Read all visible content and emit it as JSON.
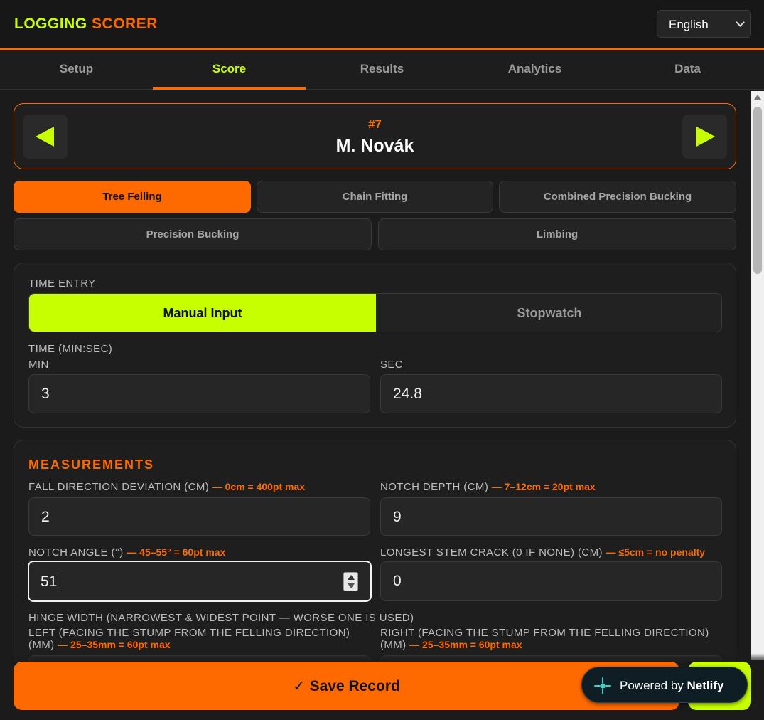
{
  "header": {
    "logo_part1": "LOGGING",
    "logo_part2": "SCORER",
    "language": "English"
  },
  "tabs": [
    "Setup",
    "Score",
    "Results",
    "Analytics",
    "Data"
  ],
  "active_tab": "Score",
  "competitor": {
    "number": "#7",
    "name": "M. Novák"
  },
  "events": {
    "row1": [
      "Tree Felling",
      "Chain Fitting",
      "Combined Precision Bucking"
    ],
    "row2": [
      "Precision Bucking",
      "Limbing"
    ],
    "active": "Tree Felling"
  },
  "time_entry": {
    "title": "TIME ENTRY",
    "modes": [
      "Manual Input",
      "Stopwatch"
    ],
    "active_mode": "Manual Input",
    "time_label": "TIME (MIN:SEC)",
    "min_label": "MIN",
    "sec_label": "SEC",
    "min_value": "3",
    "sec_value": "24.8"
  },
  "measurements": {
    "title": "MEASUREMENTS",
    "fall_label": "FALL DIRECTION DEVIATION (CM)",
    "fall_hint": "— 0cm = 400pt max",
    "fall_value": "2",
    "notch_depth_label": "NOTCH DEPTH (CM)",
    "notch_depth_hint": "— 7–12cm = 20pt max",
    "notch_depth_value": "9",
    "notch_angle_label": "NOTCH ANGLE (°)",
    "notch_angle_hint": "— 45–55° = 60pt max",
    "notch_angle_value": "51",
    "crack_label": "LONGEST STEM CRACK (0 IF NONE) (CM)",
    "crack_hint": "— ≤5cm = no penalty",
    "crack_value": "0",
    "hinge_label": "HINGE WIDTH (NARROWEST & WIDEST POINT — WORSE ONE IS USED)",
    "hinge_left_label_1": "LEFT (FACING THE STUMP FROM THE FELLING DIRECTION)",
    "hinge_left_label_2": "(MM)",
    "hinge_left_hint": "— 25–35mm = 60pt max",
    "hinge_right_label_1": "RIGHT (FACING THE STUMP FROM THE FELLING DIRECTION)",
    "hinge_right_label_2": "(MM)",
    "hinge_right_hint": "— 25–35mm = 60pt max"
  },
  "actions": {
    "save": "✓ Save Record"
  },
  "badge": {
    "prefix": "Powered by",
    "brand": "Netlify"
  },
  "colors": {
    "accent_orange": "#ff6a00",
    "accent_lime": "#c8ff00",
    "background": "#1b1b1b"
  }
}
